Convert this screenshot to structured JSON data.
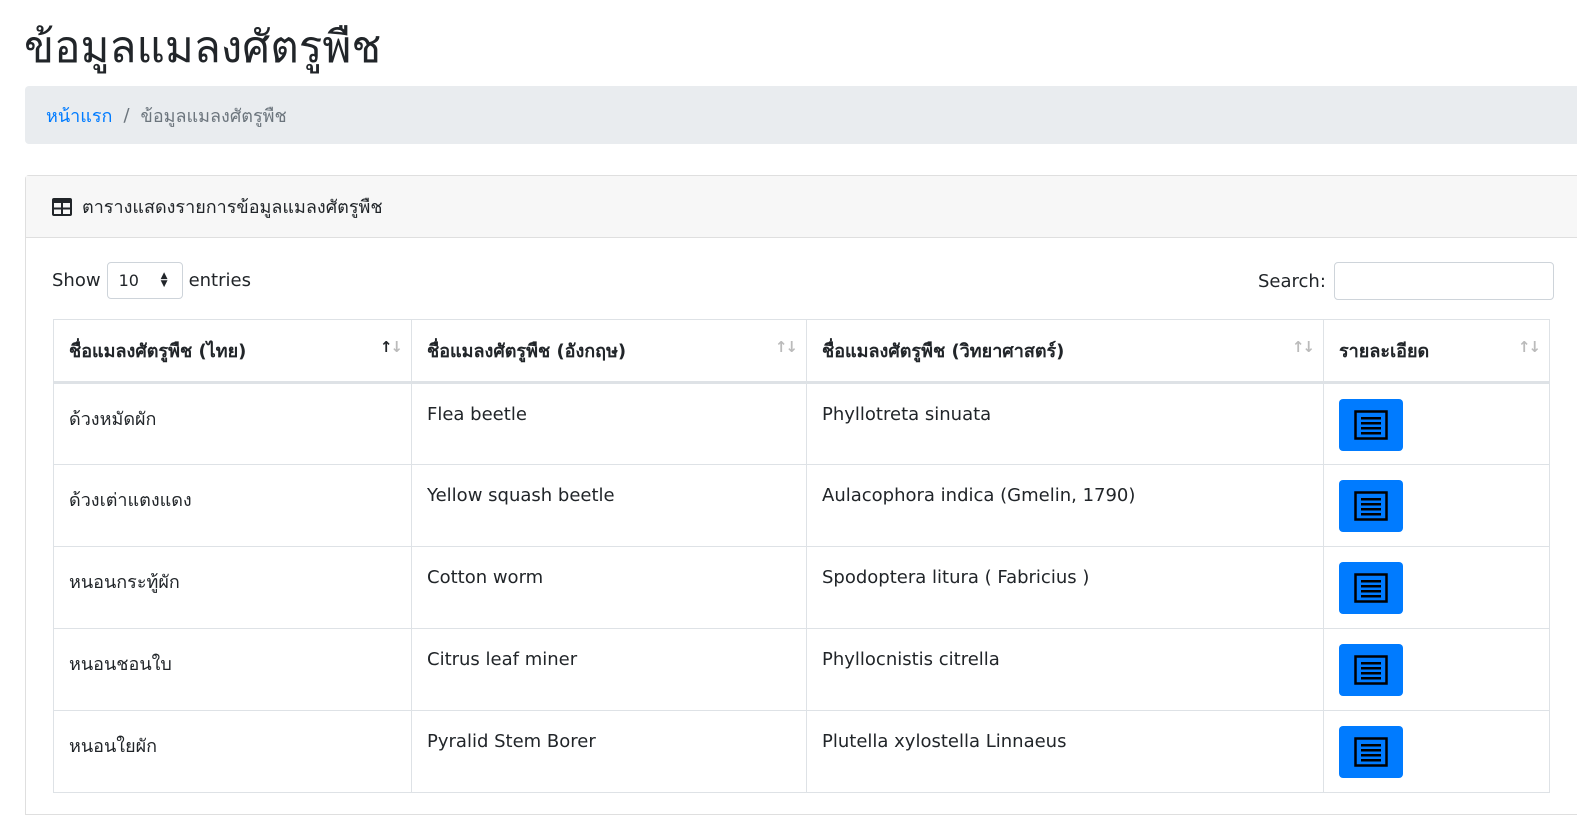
{
  "page": {
    "title": "ข้อมูลแมลงศัตรูพืช"
  },
  "breadcrumb": {
    "home": "หน้าแรก",
    "separator": "/",
    "current": "ข้อมูลแมลงศัตรูพืช"
  },
  "card": {
    "header_icon": "table-icon",
    "header_title": "ตารางแสดงรายการข้อมูลแมลงศัตรูพืช"
  },
  "length_control": {
    "show_label": "Show",
    "selected": "10",
    "entries_label": "entries"
  },
  "search": {
    "label": "Search:",
    "value": ""
  },
  "table": {
    "columns": [
      {
        "label": "ชื่อแมลงศัตรูพืช (ไทย)",
        "sort": "ascending"
      },
      {
        "label": "ชื่อแมลงศัตรูพืช (อังกฤษ)",
        "sort": "none"
      },
      {
        "label": "ชื่อแมลงศัตรูพืช (วิทยาศาสตร์)",
        "sort": "none"
      },
      {
        "label": "รายละเอียด",
        "sort": "none"
      }
    ],
    "rows": [
      {
        "thai": "ด้วงหมัดผัก",
        "english": "Flea beetle",
        "scientific": "Phyllotreta sinuata",
        "detail_icon": "list-icon"
      },
      {
        "thai": "ด้วงเต่าแตงแดง",
        "english": "Yellow squash beetle",
        "scientific": "Aulacophora indica (Gmelin, 1790)",
        "detail_icon": "list-icon"
      },
      {
        "thai": "หนอนกระทู้ผัก",
        "english": "Cotton worm",
        "scientific": "Spodoptera litura ( Fabricius )",
        "detail_icon": "list-icon"
      },
      {
        "thai": "หนอนชอนใบ",
        "english": "Citrus leaf miner",
        "scientific": "Phyllocnistis citrella",
        "detail_icon": "list-icon"
      },
      {
        "thai": "หนอนใยผัก",
        "english": "Pyralid Stem Borer",
        "scientific": "Plutella xylostella Linnaeus",
        "detail_icon": "list-icon"
      }
    ]
  },
  "colors": {
    "primary": "#007bff",
    "breadcrumb_bg": "#e9ecef",
    "card_header_bg": "#f7f7f7",
    "border": "#dee2e6"
  }
}
